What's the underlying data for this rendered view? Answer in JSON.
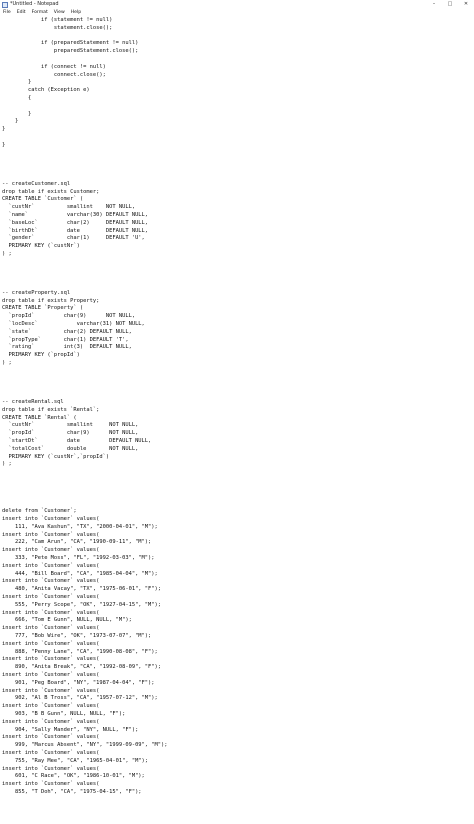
{
  "window": {
    "title": "*Untitled - Notepad",
    "controls": {
      "minimize": "–",
      "maximize": "□",
      "close": "✕"
    }
  },
  "menu": [
    "File",
    "Edit",
    "Format",
    "View",
    "Help"
  ],
  "editor": {
    "text": "            if (statement != null)\n                statement.close();\n\n            if (preparedStatement != null)\n                preparedStatement.close();\n\n            if (connect != null)\n                connect.close();\n        }\n        catch (Exception e)\n        {\n\n        }\n    }\n}\n\n}\n\n\n\n\n-- createCustomer.sql\ndrop table if exists Customer;\nCREATE TABLE `Customer` (\n  `custNr`          smallint    NOT NULL,\n  `name`            varchar(30) DEFAULT NULL,\n  `baseLoc`         char(2)     DEFAULT NULL,\n  `birthDt`         date        DEFAULT NULL,\n  `gender`          char(1)     DEFAULT 'U',\n  PRIMARY KEY (`custNr`)\n) ;\n\n\n\n\n-- createProperty.sql\ndrop table if exists Property;\nCREATE TABLE `Property` (\n  `propId`         char(9)      NOT NULL,\n  `locDesc`            varchar(31) NOT NULL,\n  `state`          char(2) DEFAULT NULL,\n  `propType`       char(1) DEFAULT 'T',\n  `rating`         int(3)  DEFAULT NULL,\n  PRIMARY KEY (`propId`)\n) ;\n\n\n\n\n-- createRental.sql\ndrop table if exists `Rental`;\nCREATE TABLE `Rental` (\n  `custNr`          smallint     NOT NULL,\n  `propId`          char(9)      NOT NULL,\n  `startDt`         date         DEFAULT NULL,\n  `totalCost`       double       NOT NULL,\n  PRIMARY KEY (`custNr`,`propId`)\n) ;\n\n\n\n\n\ndelete from `Customer`;\ninsert into `Customer` values(\n    111, \"Ava Kashun\", \"TX\", \"2000-04-01\", \"M\");\ninsert into `Customer` values(\n    222, \"Cam Arun\", \"CA\", \"1990-09-11\", \"M\");\ninsert into `Customer` values(\n    333, \"Pete Moss\", \"FL\", \"1992-03-03\", \"M\");\ninsert into `Customer` values(\n    444, \"Bill Board\", \"CA\", \"1985-04-04\", \"M\");\ninsert into `Customer` values(\n    480, \"Anita Vacay\", \"TX\", \"1975-06-01\", \"F\");\ninsert into `Customer` values(\n    555, \"Perry Scope\", \"OK\", \"1927-04-15\", \"M\");\ninsert into `Customer` values(\n    666, \"Tom E Gunn\", NULL, NULL, \"M\");\ninsert into `Customer` values(\n    777, \"Bob Wire\", \"OK\", \"1973-07-07\", \"M\");\ninsert into `Customer` values(\n    888, \"Penny Lane\", \"CA\", \"1990-08-08\", \"F\");\ninsert into `Customer` values(\n    890, \"Anita Break\", \"CA\", \"1992-08-09\", \"F\");\ninsert into `Customer` values(\n    901, \"Peg Board\", \"NY\", \"1987-04-04\", \"F\");\ninsert into `Customer` values(\n    902, \"Al B Tross\", \"CA\", \"1957-07-12\", \"M\");\ninsert into `Customer` values(\n    903, \"B B Gunn\", NULL, NULL, \"F\");\ninsert into `Customer` values(\n    904, \"Sally Mander\", \"NY\", NULL, \"F\");\ninsert into `Customer` values(\n    999, \"Marcus Absent\", \"NY\", \"1999-09-09\", \"M\");\ninsert into `Customer` values(\n    755, \"Ray Mee\", \"CA\", \"1965-04-01\", \"M\");\ninsert into `Customer` values(\n    601, \"C Race\", \"OK\", \"1986-10-01\", \"M\");\ninsert into `Customer` values(\n    855, \"T Doh\", \"CA\", \"1975-04-15\", \"F\");"
  }
}
